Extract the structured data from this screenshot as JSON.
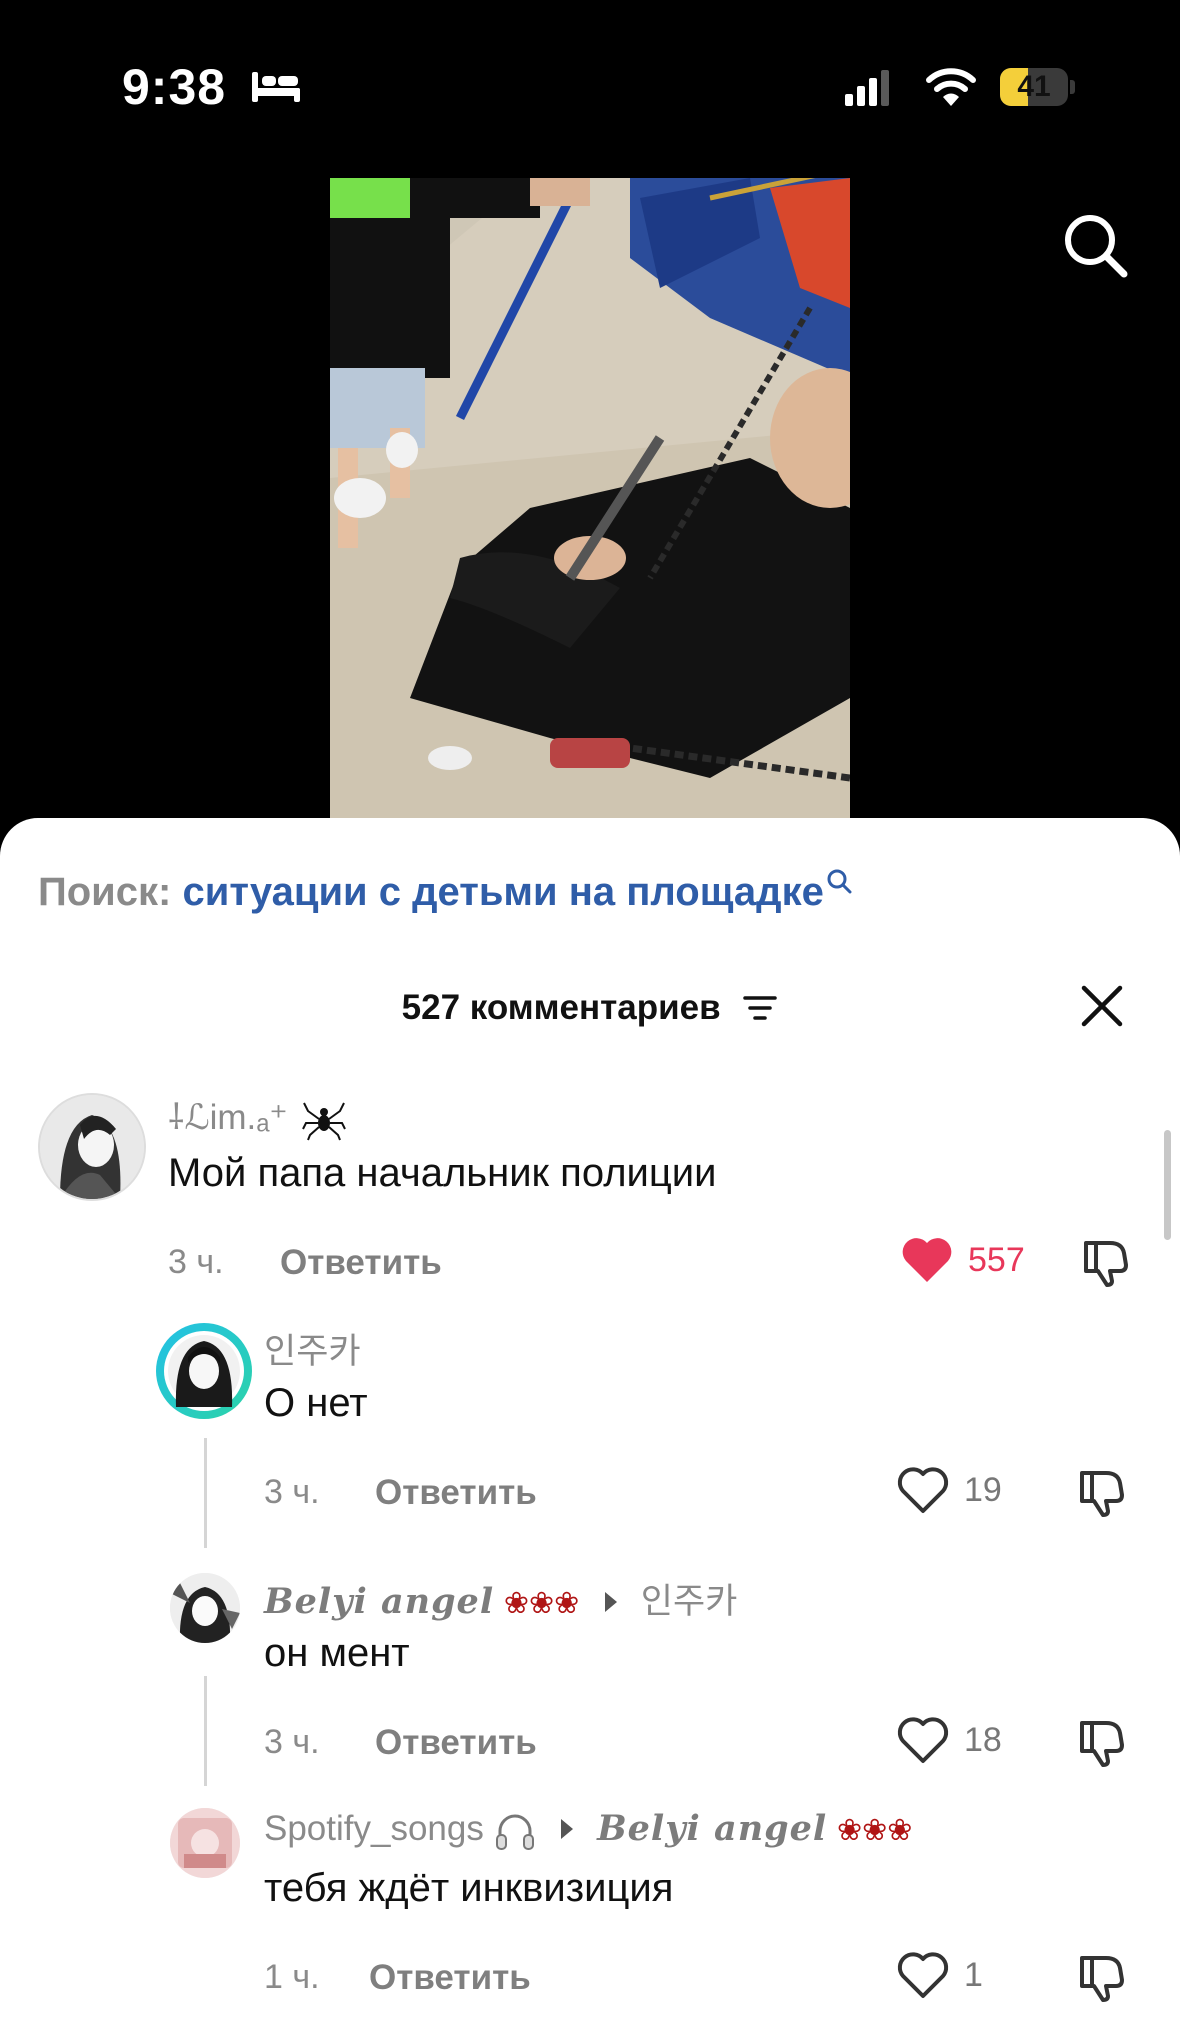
{
  "status_bar": {
    "time": "9:38",
    "battery": "41",
    "battery_level": 0.41
  },
  "search": {
    "label": "Поиск:",
    "query": "ситуации с детьми на площадке"
  },
  "comments_header": {
    "count_label": "527 комментариев"
  },
  "colors": {
    "accent_blue": "#2f5da8",
    "like_red": "#e8375a",
    "battery_yellow": "#f4cf3a"
  },
  "comments": [
    {
      "username": "⸸ℒim.ₐ⁺",
      "text": "Мой папа начальник полиции",
      "time": "3 ч.",
      "reply_label": "Ответить",
      "likes": "557",
      "liked": true
    },
    {
      "username": "인주카",
      "text": "О нет",
      "time": "3 ч.",
      "reply_label": "Ответить",
      "likes": "19",
      "liked": false
    },
    {
      "username": "Belyi angel",
      "reply_to": "인주카",
      "text": "он мент",
      "time": "3 ч.",
      "reply_label": "Ответить",
      "likes": "18",
      "liked": false
    },
    {
      "username": "Spotify_songs",
      "reply_to": "Belyi angel",
      "text": "тебя ждёт инквизиция",
      "time": "1 ч.",
      "reply_label": "Ответить",
      "likes": "1",
      "liked": false
    }
  ]
}
